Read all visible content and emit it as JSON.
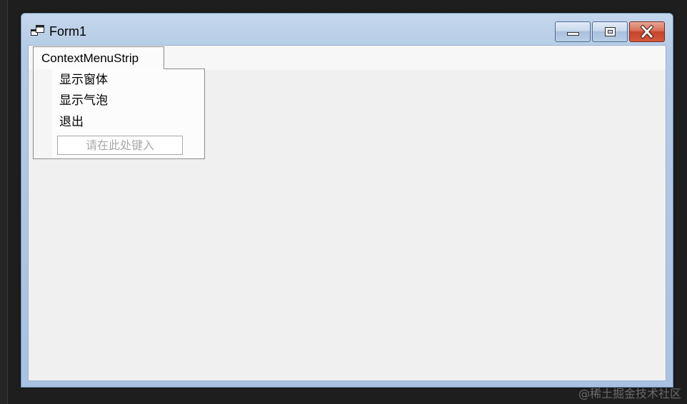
{
  "window": {
    "title": "Form1"
  },
  "context_menu": {
    "header": "ContextMenuStrip",
    "items": [
      {
        "label": "显示窗体"
      },
      {
        "label": "显示气泡"
      },
      {
        "label": "退出"
      }
    ],
    "type_here_placeholder": "请在此处键入"
  },
  "watermark": "@稀土掘金技术社区",
  "colors": {
    "close_button": "#c7432a",
    "titlebar": "#b5cbe5",
    "client_background": "#f0f0f0"
  },
  "icons": {
    "app": "window-icon",
    "minimize": "minimize-icon",
    "maximize": "maximize-icon",
    "close": "close-icon"
  }
}
